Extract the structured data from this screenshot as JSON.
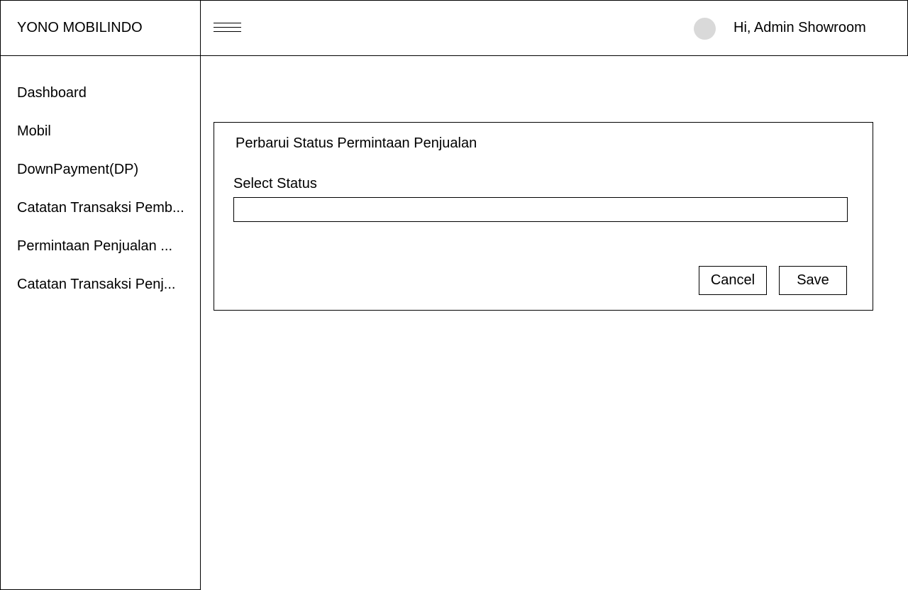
{
  "app": {
    "brand": "YONO MOBILINDO"
  },
  "header": {
    "menu_icon": "hamburger-icon",
    "greeting": "Hi, Admin Showroom",
    "avatar_color": "#d9d9d9"
  },
  "sidebar": {
    "items": [
      {
        "label": "Dashboard"
      },
      {
        "label": "Mobil"
      },
      {
        "label": "DownPayment(DP)"
      },
      {
        "label": "Catatan Transaksi Pemb..."
      },
      {
        "label": "Permintaan Penjualan ..."
      },
      {
        "label": "Catatan Transaksi Penj..."
      }
    ]
  },
  "modal": {
    "title": "Perbarui Status Permintaan Penjualan",
    "field_label": "Select Status",
    "select_value": "",
    "cancel_label": "Cancel",
    "save_label": "Save"
  }
}
